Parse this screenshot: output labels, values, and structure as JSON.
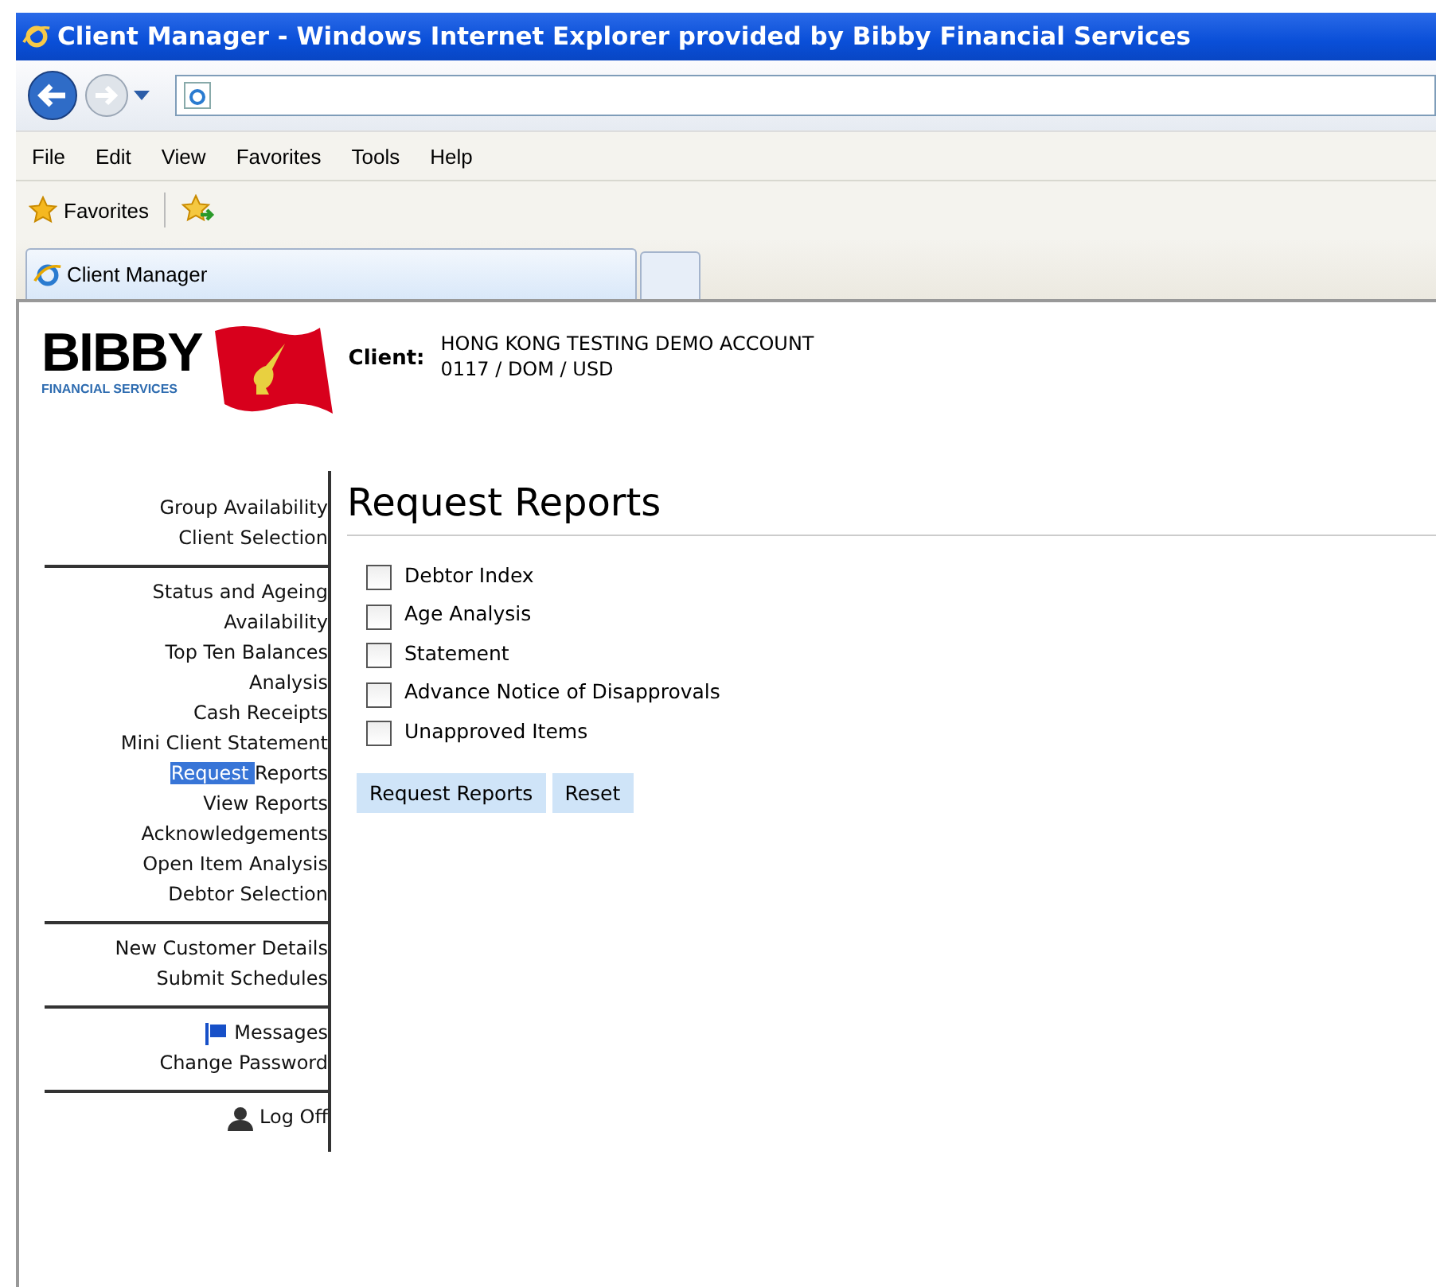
{
  "window": {
    "title": "Client Manager - Windows Internet Explorer provided by Bibby Financial Services"
  },
  "menu": [
    "File",
    "Edit",
    "View",
    "Favorites",
    "Tools",
    "Help"
  ],
  "favorites_bar": {
    "label": "Favorites"
  },
  "tabs": [
    {
      "label": "Client Manager",
      "selected": true
    },
    {
      "selected": false
    }
  ],
  "logo": {
    "name": "BIBBY",
    "tagline": "FINANCIAL SERVICES"
  },
  "client": {
    "label": "Client:",
    "name": "HONG KONG TESTING DEMO ACCOUNT",
    "code": "0117 / DOM / USD"
  },
  "sidebar": {
    "groups": [
      [
        {
          "kind": "plain",
          "parts": [
            {
              "text": "Group Availability",
              "highlighted": false
            }
          ]
        },
        {
          "kind": "plain",
          "parts": [
            {
              "text": "Client Selection",
              "highlighted": false
            }
          ]
        }
      ],
      [
        {
          "kind": "plain",
          "parts": [
            {
              "text": "Status and Ageing",
              "highlighted": false
            }
          ]
        },
        {
          "kind": "plain",
          "parts": [
            {
              "text": "Availability",
              "highlighted": false
            }
          ]
        },
        {
          "kind": "plain",
          "parts": [
            {
              "text": "Top Ten Balances",
              "highlighted": false
            }
          ]
        },
        {
          "kind": "plain",
          "parts": [
            {
              "text": "Analysis",
              "highlighted": false
            }
          ]
        },
        {
          "kind": "plain",
          "parts": [
            {
              "text": "Cash Receipts",
              "highlighted": false
            }
          ]
        },
        {
          "kind": "plain",
          "parts": [
            {
              "text": "Mini Client Statement",
              "highlighted": false
            }
          ]
        },
        {
          "kind": "plain",
          "parts": [
            {
              "text": "Request ",
              "highlighted": true
            },
            {
              "text": "Reports",
              "highlighted": false
            }
          ]
        },
        {
          "kind": "plain",
          "parts": [
            {
              "text": "View Reports",
              "highlighted": false
            }
          ]
        },
        {
          "kind": "plain",
          "parts": [
            {
              "text": "Acknowledgements",
              "highlighted": false
            }
          ]
        },
        {
          "kind": "plain",
          "parts": [
            {
              "text": "Open Item Analysis",
              "highlighted": false
            }
          ]
        },
        {
          "kind": "plain",
          "parts": [
            {
              "text": "Debtor Selection",
              "highlighted": false
            }
          ]
        }
      ],
      [
        {
          "kind": "plain",
          "parts": [
            {
              "text": "New Customer Details",
              "highlighted": false
            }
          ]
        },
        {
          "kind": "plain",
          "parts": [
            {
              "text": "Submit Schedules",
              "highlighted": false
            }
          ]
        }
      ],
      [
        {
          "kind": "flag",
          "parts": [
            {
              "text": "Messages",
              "highlighted": false
            }
          ]
        },
        {
          "kind": "plain",
          "parts": [
            {
              "text": "Change Password",
              "highlighted": false
            }
          ]
        }
      ],
      [
        {
          "kind": "user",
          "parts": [
            {
              "text": "Log Off",
              "highlighted": false
            }
          ]
        }
      ]
    ]
  },
  "main": {
    "heading": "Request Reports",
    "reports": [
      {
        "label": "Debtor Index",
        "checked": false
      },
      {
        "label": "Age Analysis",
        "checked": false
      },
      {
        "label": "Statement",
        "checked": false
      },
      {
        "label": "Advance Notice of Disapprovals",
        "checked": false
      },
      {
        "label": "Unapproved Items",
        "checked": false
      }
    ],
    "buttons": [
      "Request Reports",
      "Reset"
    ]
  }
}
